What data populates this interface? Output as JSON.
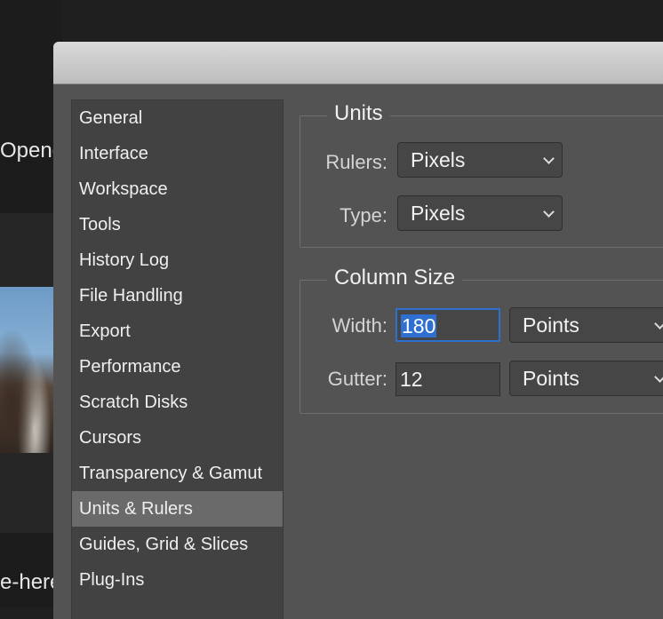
{
  "background": {
    "text_top": "Opene",
    "text_bottom": "e-here"
  },
  "sidebar": {
    "items": [
      {
        "label": "General"
      },
      {
        "label": "Interface"
      },
      {
        "label": "Workspace"
      },
      {
        "label": "Tools"
      },
      {
        "label": "History Log"
      },
      {
        "label": "File Handling"
      },
      {
        "label": "Export"
      },
      {
        "label": "Performance"
      },
      {
        "label": "Scratch Disks"
      },
      {
        "label": "Cursors"
      },
      {
        "label": "Transparency & Gamut"
      },
      {
        "label": "Units & Rulers"
      },
      {
        "label": "Guides, Grid & Slices"
      },
      {
        "label": "Plug-Ins"
      }
    ],
    "selected": "Units & Rulers"
  },
  "units": {
    "legend": "Units",
    "rulers_label": "Rulers:",
    "rulers_value": "Pixels",
    "type_label": "Type:",
    "type_value": "Pixels"
  },
  "column_size": {
    "legend": "Column Size",
    "width_label": "Width:",
    "width_value": "180",
    "width_unit": "Points",
    "gutter_label": "Gutter:",
    "gutter_value": "12",
    "gutter_unit": "Points"
  },
  "colors": {
    "selection_accent": "#2f6fd0",
    "dialog_bg": "#535353",
    "sidebar_bg": "#424242",
    "sidebar_selected": "#6a6a6a"
  }
}
